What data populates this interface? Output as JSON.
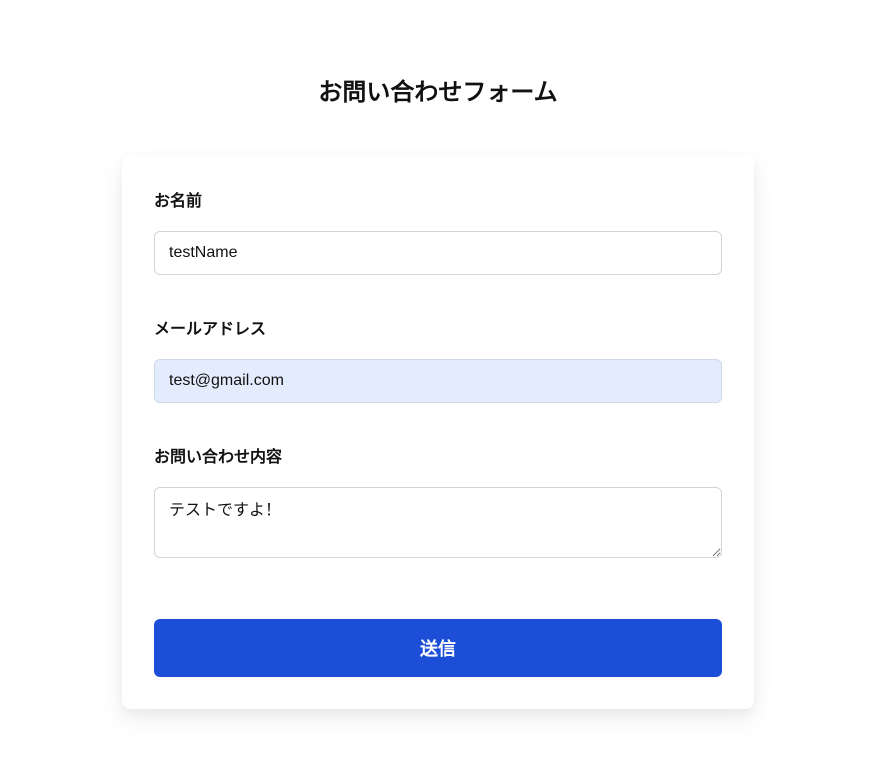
{
  "title": "お問い合わせフォーム",
  "form": {
    "name": {
      "label": "お名前",
      "value": "testName"
    },
    "email": {
      "label": "メールアドレス",
      "value": "test@gmail.com"
    },
    "message": {
      "label": "お問い合わせ内容",
      "value": "テストですよ！"
    },
    "submit_label": "送信"
  }
}
